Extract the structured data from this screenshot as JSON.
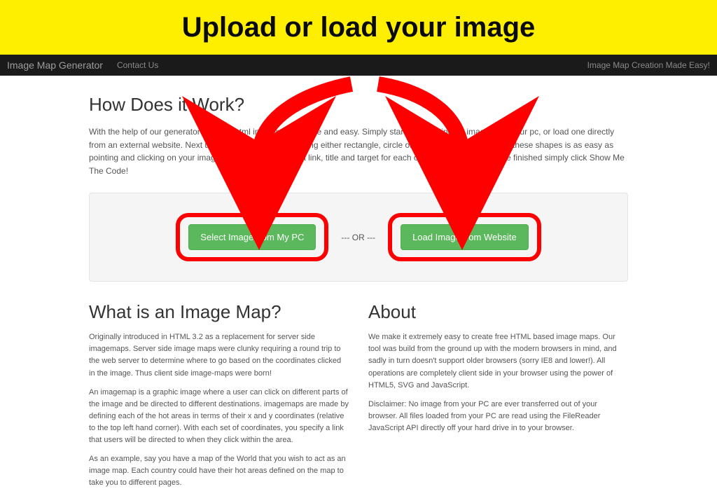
{
  "banner": {
    "title": "Upload or load your image"
  },
  "nav": {
    "brand": "Image Map Generator",
    "contact": "Contact Us",
    "tagline": "Image Map Creation Made Easy!"
  },
  "how": {
    "title": "How Does it Work?",
    "body": "With the help of our generator creating html imagemaps is free and easy. Simply start by selecting an image from your pc, or load one directly from an external website. Next up create your hot areas using either rectangle, circle or polygon shapes. Creating these shapes is as easy as pointing and clicking on your image. Don't forget to enter a link, title and target for each of them. Then once you're finished simply click Show Me The Code!"
  },
  "buttons": {
    "select": "Select Image from My PC",
    "or": "--- OR ---",
    "load": "Load Image from Website"
  },
  "what": {
    "title": "What is an Image Map?",
    "p1": "Originally introduced in HTML 3.2 as a replacement for server side imagemaps. Server side image maps were clunky requiring a round trip to the web server to determine where to go based on the coordinates clicked in the image. Thus client side image-maps were born!",
    "p2": "An imagemap is a graphic image where a user can click on different parts of the image and be directed to different destinations. imagemaps are made by defining each of the hot areas in terms of their x and y coordinates (relative to the top left hand corner). With each set of coordinates, you specify a link that users will be directed to when they click within the area.",
    "p3": "As an example, say you have a map of the World that you wish to act as an image map. Each country could have their hot areas defined on the map to take you to different pages."
  },
  "about": {
    "title": "About",
    "p1": "We make it extremely easy to create free HTML based image maps. Our tool was build from the ground up with the modern browsers in mind, and sadly in turn doesn't support older browsers (sorry IE8 and lower!). All operations are completely client side in your browser using the power of HTML5, SVG and JavaScript.",
    "p2": "Disclaimer: No image from your PC are ever transferred out of your browser. All files loaded from your PC are read using the FileReader JavaScript API directly off your hard drive in to your browser."
  }
}
